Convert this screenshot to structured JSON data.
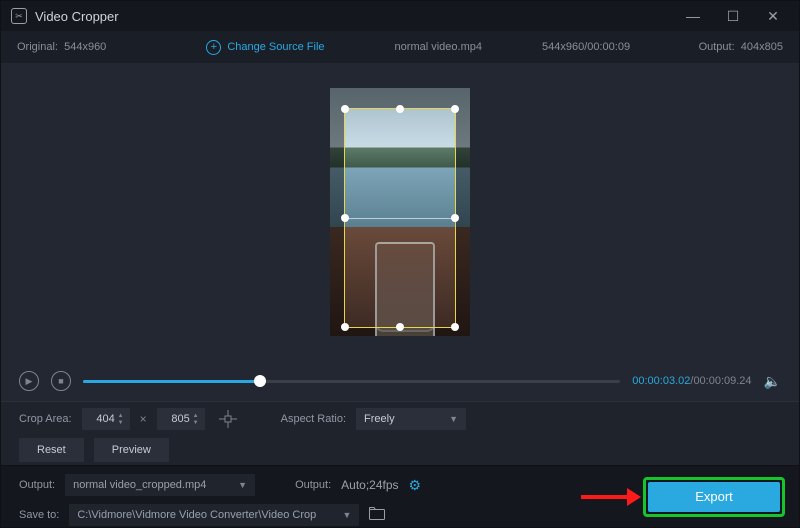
{
  "title": "Video Cropper",
  "infobar": {
    "original_label": "Original:",
    "original_value": "544x960",
    "change_source": "Change Source File",
    "filename": "normal video.mp4",
    "src_dims_time": "544x960/00:00:09",
    "output_label": "Output:",
    "output_value": "404x805"
  },
  "playback": {
    "current": "00:00:03.02",
    "total": "00:00:09.24"
  },
  "controls": {
    "crop_area_label": "Crop Area:",
    "width": "404",
    "height": "805",
    "aspect_label": "Aspect Ratio:",
    "aspect_value": "Freely",
    "reset": "Reset",
    "preview": "Preview"
  },
  "footer": {
    "output_label": "Output:",
    "output_file": "normal video_cropped.mp4",
    "settings_label": "Output:",
    "settings_value": "Auto;24fps",
    "saveto_label": "Save to:",
    "saveto_path": "C:\\Vidmore\\Vidmore Video Converter\\Video Crop",
    "export": "Export"
  }
}
